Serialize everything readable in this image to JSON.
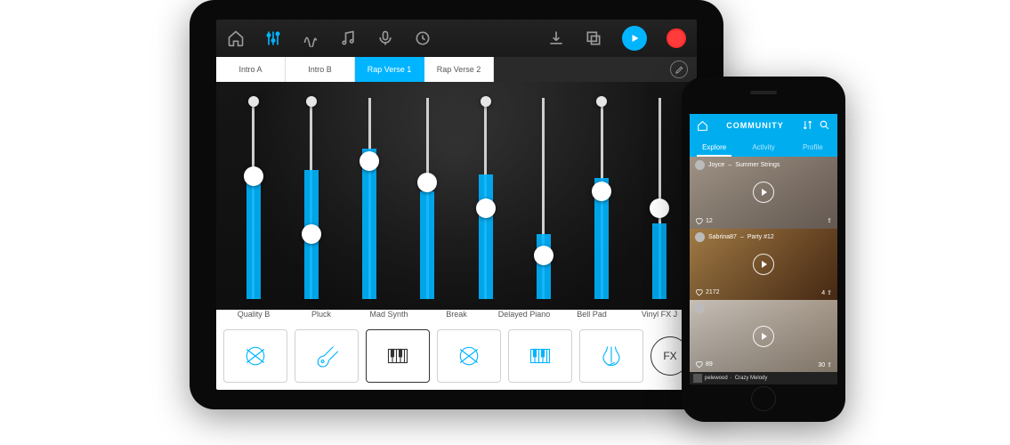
{
  "accent": "#00b4ff",
  "tablet": {
    "toolbar_icons": [
      "home",
      "mixer",
      "eq",
      "note",
      "mic",
      "loop",
      "download",
      "export",
      "play",
      "record"
    ],
    "tabs": [
      {
        "label": "Intro A",
        "active": false
      },
      {
        "label": "Intro B",
        "active": false
      },
      {
        "label": "Rap Verse 1",
        "active": true
      },
      {
        "label": "Rap Verse 2",
        "active": false
      }
    ],
    "channels": [
      {
        "level": 0.58,
        "knob": 0.35,
        "extra_top": true
      },
      {
        "level": 0.6,
        "knob": 0.62,
        "extra_top": true
      },
      {
        "level": 0.7,
        "knob": 0.28
      },
      {
        "level": 0.5,
        "knob": 0.38
      },
      {
        "level": 0.58,
        "knob": 0.5,
        "extra_top": true
      },
      {
        "level": 0.3,
        "knob": 0.72
      },
      {
        "level": 0.56,
        "knob": 0.42,
        "extra_top": true
      },
      {
        "level": 0.35,
        "knob": 0.5
      }
    ],
    "instruments": [
      {
        "name": "Quality B",
        "icon": "drum",
        "style": "blue"
      },
      {
        "name": "Pluck",
        "icon": "guitar",
        "style": "blue"
      },
      {
        "name": "Mad Synth",
        "icon": "keys",
        "style": "dark"
      },
      {
        "name": "Break",
        "icon": "drum",
        "style": "blue"
      },
      {
        "name": "Delayed Piano",
        "icon": "keys",
        "style": "blue"
      },
      {
        "name": "Bell Pad",
        "icon": "violin",
        "style": "blue"
      },
      {
        "name": "Vinyl FX J",
        "icon": "fx",
        "style": "fx"
      }
    ]
  },
  "phone": {
    "header_title": "COMMUNITY",
    "tabs": [
      {
        "label": "Explore",
        "active": true
      },
      {
        "label": "Activity",
        "active": false
      },
      {
        "label": "Profile",
        "active": false
      }
    ],
    "feed": [
      {
        "user": "Joyce",
        "title": "Summer Strings",
        "likes": 12,
        "shares": ""
      },
      {
        "user": "Sabrina87",
        "title": "Party #12",
        "likes": 2172,
        "shares": 4
      },
      {
        "user": "",
        "title": "",
        "likes": 89,
        "shares": 30
      }
    ],
    "now_playing": {
      "user": "pelewood",
      "title": "Crazy Melody"
    }
  }
}
